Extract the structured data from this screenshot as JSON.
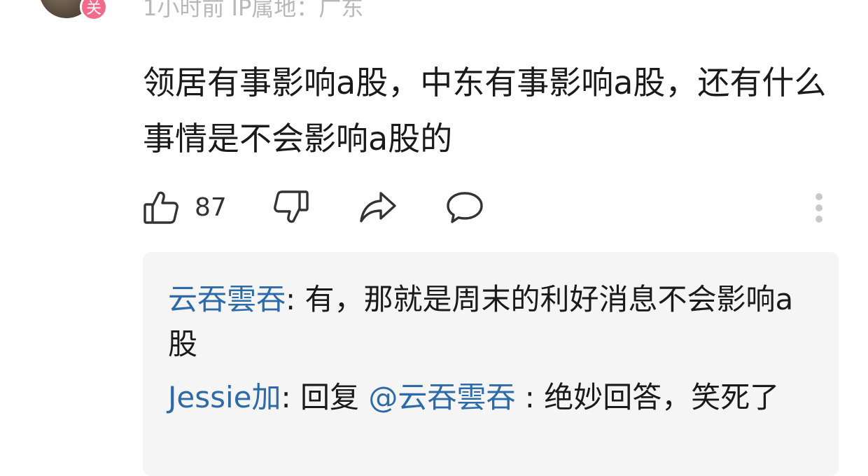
{
  "comment": {
    "avatar_badge": "关",
    "meta": "1小时前  IP属地：广东",
    "text": "领居有事影响a股，中东有事影响a股，还有什么事情是不会影响a股的",
    "like_count": "87"
  },
  "icons": {
    "like": "thumbs-up-icon",
    "dislike": "thumbs-down-icon",
    "share": "share-icon",
    "reply": "comment-icon",
    "more": "more-vertical-icon"
  },
  "replies": [
    {
      "user": "云吞雲吞",
      "sep": ": ",
      "text": "有，那就是周末的利好消息不会影响a股"
    },
    {
      "user": "Jessie加",
      "sep": ": ",
      "prefix": "回复 ",
      "mention": "@云吞雲吞",
      "sep2": " : ",
      "text": "绝妙回答，笑死了"
    }
  ],
  "colors": {
    "username": "#2d6aa8",
    "meta": "#b8b8b8",
    "reply_bg": "#f5f5f5",
    "badge": "#f26b8a"
  }
}
